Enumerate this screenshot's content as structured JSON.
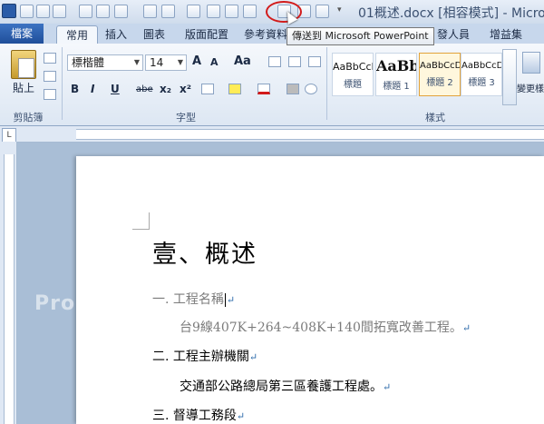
{
  "window": {
    "title": "01概述.docx [相容模式] - Micro",
    "tooltip": "傳送到 Microsoft PowerPoint"
  },
  "tabs": {
    "file": "檔案",
    "items": [
      {
        "label": "常用"
      },
      {
        "label": "插入"
      },
      {
        "label": "圖表"
      },
      {
        "label": "版面配置"
      },
      {
        "label": "參考資料"
      },
      {
        "label": "發人員"
      },
      {
        "label": "增益集"
      }
    ]
  },
  "ribbon": {
    "clipboard": {
      "paste": "貼上",
      "group": "剪貼簿"
    },
    "font": {
      "name": "標楷體",
      "size": "14",
      "grow": "A",
      "shrink": "A",
      "case": "Aa",
      "bold": "B",
      "italic": "I",
      "underline": "U",
      "strike": "abe",
      "subscript": "x₂",
      "superscript": "x²",
      "group": "字型"
    },
    "styles": {
      "items": [
        {
          "sample": "AaBbCcI",
          "name": "標題"
        },
        {
          "sample": "AaBb",
          "name": "標題 1"
        },
        {
          "sample": "AaBbCcDc",
          "name": "標題 2"
        },
        {
          "sample": "AaBbCcDc",
          "name": "標題 3"
        }
      ],
      "group": "樣式",
      "change_styles": "變更樣式"
    }
  },
  "document": {
    "heading": "壹、概述",
    "lines": [
      {
        "text": "一. 工程名稱",
        "mark": "↵"
      },
      {
        "text": "台9線407K+264~408K+140間拓寬改善工程。",
        "mark": "↵"
      },
      {
        "text": "二. 工程主辦機關",
        "mark": "↵"
      },
      {
        "text": "交通部公路總局第三區養護工程處。",
        "mark": "↵"
      },
      {
        "text": "三. 督導工務段",
        "mark": "↵"
      }
    ]
  },
  "watermark": "Pro",
  "colors": {
    "highlight_circle": "#d21b1b",
    "file_tab": "#2b5ca8"
  }
}
